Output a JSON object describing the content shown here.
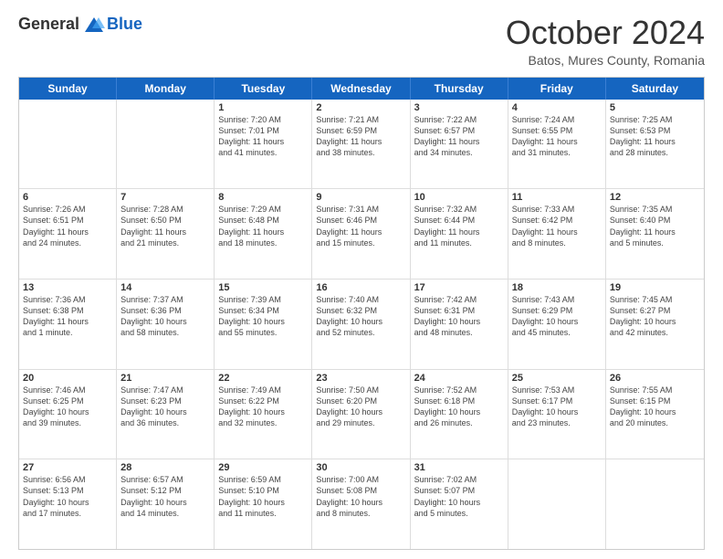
{
  "header": {
    "logo_general": "General",
    "logo_blue": "Blue",
    "month_title": "October 2024",
    "location": "Batos, Mures County, Romania"
  },
  "weekdays": [
    "Sunday",
    "Monday",
    "Tuesday",
    "Wednesday",
    "Thursday",
    "Friday",
    "Saturday"
  ],
  "weeks": [
    [
      {
        "day": "",
        "lines": []
      },
      {
        "day": "",
        "lines": []
      },
      {
        "day": "1",
        "lines": [
          "Sunrise: 7:20 AM",
          "Sunset: 7:01 PM",
          "Daylight: 11 hours",
          "and 41 minutes."
        ]
      },
      {
        "day": "2",
        "lines": [
          "Sunrise: 7:21 AM",
          "Sunset: 6:59 PM",
          "Daylight: 11 hours",
          "and 38 minutes."
        ]
      },
      {
        "day": "3",
        "lines": [
          "Sunrise: 7:22 AM",
          "Sunset: 6:57 PM",
          "Daylight: 11 hours",
          "and 34 minutes."
        ]
      },
      {
        "day": "4",
        "lines": [
          "Sunrise: 7:24 AM",
          "Sunset: 6:55 PM",
          "Daylight: 11 hours",
          "and 31 minutes."
        ]
      },
      {
        "day": "5",
        "lines": [
          "Sunrise: 7:25 AM",
          "Sunset: 6:53 PM",
          "Daylight: 11 hours",
          "and 28 minutes."
        ]
      }
    ],
    [
      {
        "day": "6",
        "lines": [
          "Sunrise: 7:26 AM",
          "Sunset: 6:51 PM",
          "Daylight: 11 hours",
          "and 24 minutes."
        ]
      },
      {
        "day": "7",
        "lines": [
          "Sunrise: 7:28 AM",
          "Sunset: 6:50 PM",
          "Daylight: 11 hours",
          "and 21 minutes."
        ]
      },
      {
        "day": "8",
        "lines": [
          "Sunrise: 7:29 AM",
          "Sunset: 6:48 PM",
          "Daylight: 11 hours",
          "and 18 minutes."
        ]
      },
      {
        "day": "9",
        "lines": [
          "Sunrise: 7:31 AM",
          "Sunset: 6:46 PM",
          "Daylight: 11 hours",
          "and 15 minutes."
        ]
      },
      {
        "day": "10",
        "lines": [
          "Sunrise: 7:32 AM",
          "Sunset: 6:44 PM",
          "Daylight: 11 hours",
          "and 11 minutes."
        ]
      },
      {
        "day": "11",
        "lines": [
          "Sunrise: 7:33 AM",
          "Sunset: 6:42 PM",
          "Daylight: 11 hours",
          "and 8 minutes."
        ]
      },
      {
        "day": "12",
        "lines": [
          "Sunrise: 7:35 AM",
          "Sunset: 6:40 PM",
          "Daylight: 11 hours",
          "and 5 minutes."
        ]
      }
    ],
    [
      {
        "day": "13",
        "lines": [
          "Sunrise: 7:36 AM",
          "Sunset: 6:38 PM",
          "Daylight: 11 hours",
          "and 1 minute."
        ]
      },
      {
        "day": "14",
        "lines": [
          "Sunrise: 7:37 AM",
          "Sunset: 6:36 PM",
          "Daylight: 10 hours",
          "and 58 minutes."
        ]
      },
      {
        "day": "15",
        "lines": [
          "Sunrise: 7:39 AM",
          "Sunset: 6:34 PM",
          "Daylight: 10 hours",
          "and 55 minutes."
        ]
      },
      {
        "day": "16",
        "lines": [
          "Sunrise: 7:40 AM",
          "Sunset: 6:32 PM",
          "Daylight: 10 hours",
          "and 52 minutes."
        ]
      },
      {
        "day": "17",
        "lines": [
          "Sunrise: 7:42 AM",
          "Sunset: 6:31 PM",
          "Daylight: 10 hours",
          "and 48 minutes."
        ]
      },
      {
        "day": "18",
        "lines": [
          "Sunrise: 7:43 AM",
          "Sunset: 6:29 PM",
          "Daylight: 10 hours",
          "and 45 minutes."
        ]
      },
      {
        "day": "19",
        "lines": [
          "Sunrise: 7:45 AM",
          "Sunset: 6:27 PM",
          "Daylight: 10 hours",
          "and 42 minutes."
        ]
      }
    ],
    [
      {
        "day": "20",
        "lines": [
          "Sunrise: 7:46 AM",
          "Sunset: 6:25 PM",
          "Daylight: 10 hours",
          "and 39 minutes."
        ]
      },
      {
        "day": "21",
        "lines": [
          "Sunrise: 7:47 AM",
          "Sunset: 6:23 PM",
          "Daylight: 10 hours",
          "and 36 minutes."
        ]
      },
      {
        "day": "22",
        "lines": [
          "Sunrise: 7:49 AM",
          "Sunset: 6:22 PM",
          "Daylight: 10 hours",
          "and 32 minutes."
        ]
      },
      {
        "day": "23",
        "lines": [
          "Sunrise: 7:50 AM",
          "Sunset: 6:20 PM",
          "Daylight: 10 hours",
          "and 29 minutes."
        ]
      },
      {
        "day": "24",
        "lines": [
          "Sunrise: 7:52 AM",
          "Sunset: 6:18 PM",
          "Daylight: 10 hours",
          "and 26 minutes."
        ]
      },
      {
        "day": "25",
        "lines": [
          "Sunrise: 7:53 AM",
          "Sunset: 6:17 PM",
          "Daylight: 10 hours",
          "and 23 minutes."
        ]
      },
      {
        "day": "26",
        "lines": [
          "Sunrise: 7:55 AM",
          "Sunset: 6:15 PM",
          "Daylight: 10 hours",
          "and 20 minutes."
        ]
      }
    ],
    [
      {
        "day": "27",
        "lines": [
          "Sunrise: 6:56 AM",
          "Sunset: 5:13 PM",
          "Daylight: 10 hours",
          "and 17 minutes."
        ]
      },
      {
        "day": "28",
        "lines": [
          "Sunrise: 6:57 AM",
          "Sunset: 5:12 PM",
          "Daylight: 10 hours",
          "and 14 minutes."
        ]
      },
      {
        "day": "29",
        "lines": [
          "Sunrise: 6:59 AM",
          "Sunset: 5:10 PM",
          "Daylight: 10 hours",
          "and 11 minutes."
        ]
      },
      {
        "day": "30",
        "lines": [
          "Sunrise: 7:00 AM",
          "Sunset: 5:08 PM",
          "Daylight: 10 hours",
          "and 8 minutes."
        ]
      },
      {
        "day": "31",
        "lines": [
          "Sunrise: 7:02 AM",
          "Sunset: 5:07 PM",
          "Daylight: 10 hours",
          "and 5 minutes."
        ]
      },
      {
        "day": "",
        "lines": []
      },
      {
        "day": "",
        "lines": []
      }
    ]
  ]
}
